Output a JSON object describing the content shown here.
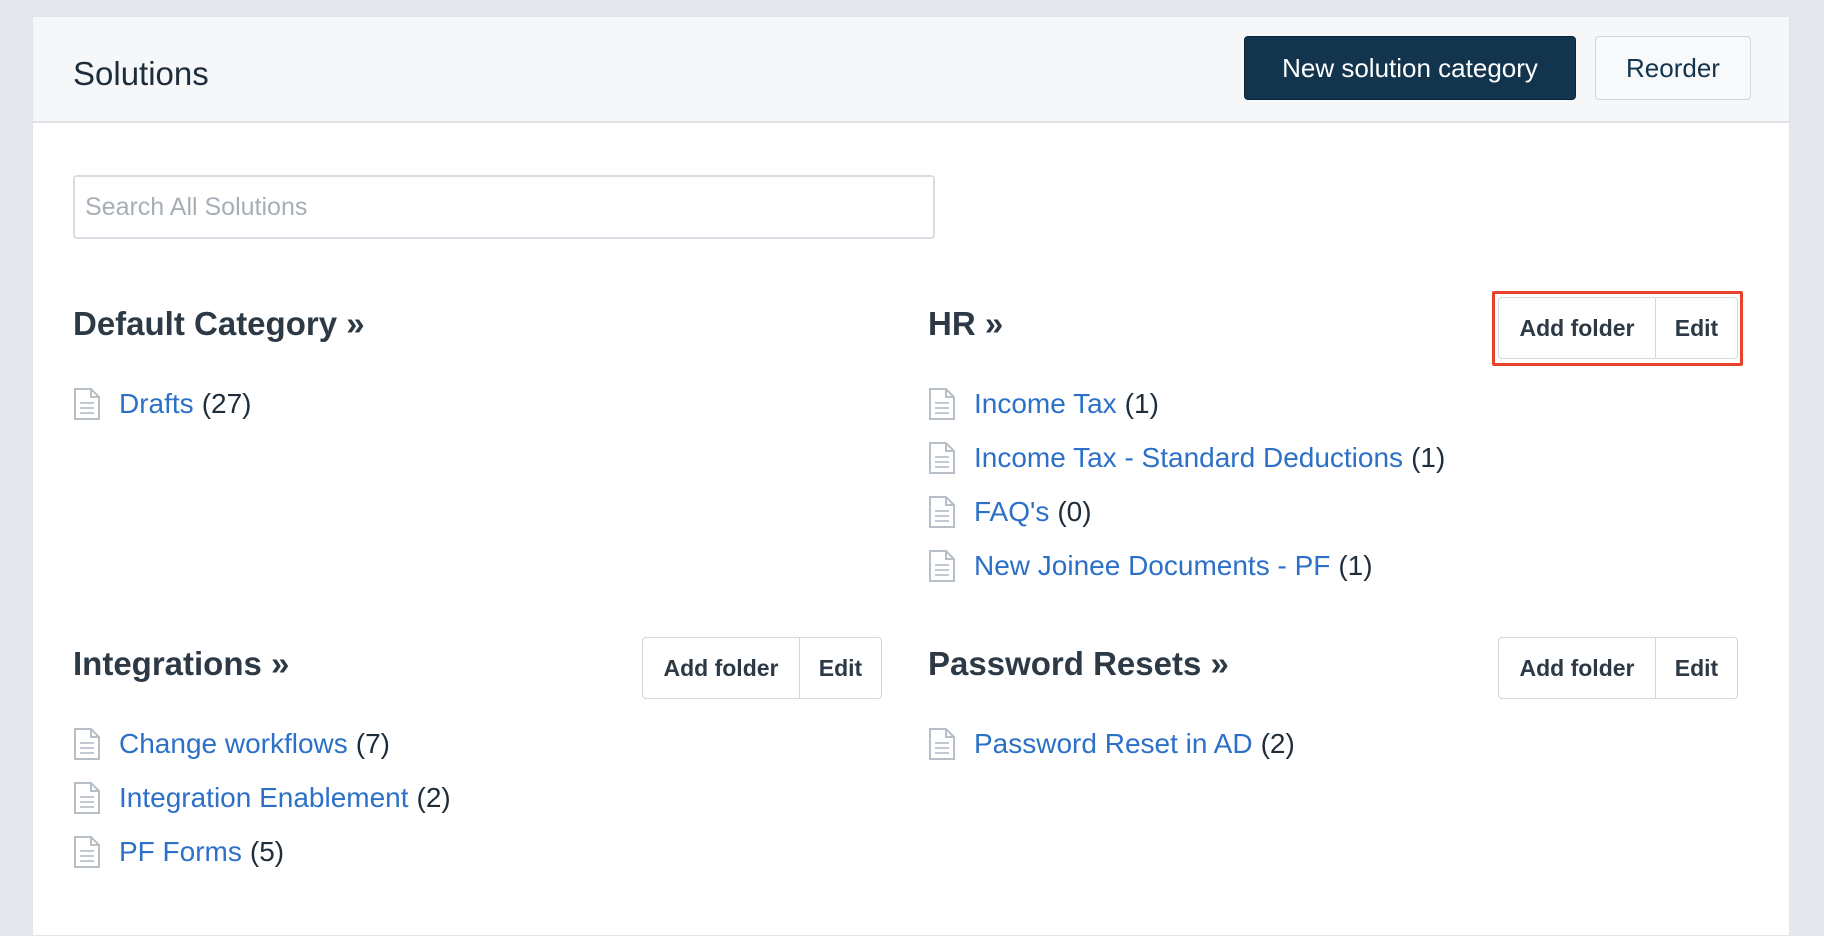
{
  "header": {
    "title": "Solutions",
    "new_category_label": "New solution category",
    "reorder_label": "Reorder"
  },
  "search": {
    "placeholder": "Search All Solutions"
  },
  "actions": {
    "add_folder": "Add folder",
    "edit": "Edit"
  },
  "categories": [
    {
      "title": "Default Category »",
      "folders": [
        {
          "name": "Drafts",
          "count": "(27)"
        }
      ]
    },
    {
      "title": "HR »",
      "folders": [
        {
          "name": "Income Tax",
          "count": "(1)"
        },
        {
          "name": "Income Tax - Standard Deductions",
          "count": "(1)"
        },
        {
          "name": "FAQ's",
          "count": "(0)"
        },
        {
          "name": "New Joinee Documents - PF",
          "count": "(1)"
        }
      ]
    },
    {
      "title": "Integrations »",
      "folders": [
        {
          "name": "Change workflows",
          "count": "(7)"
        },
        {
          "name": "Integration Enablement",
          "count": "(2)"
        },
        {
          "name": "PF Forms",
          "count": "(5)"
        }
      ]
    },
    {
      "title": "Password Resets »",
      "folders": [
        {
          "name": "Password Reset in AD",
          "count": "(2)"
        }
      ]
    }
  ],
  "icons": {
    "folder": "document-icon"
  },
  "colors": {
    "primary": "#12344d",
    "link": "#2c70c8",
    "highlight": "#e8412c"
  }
}
